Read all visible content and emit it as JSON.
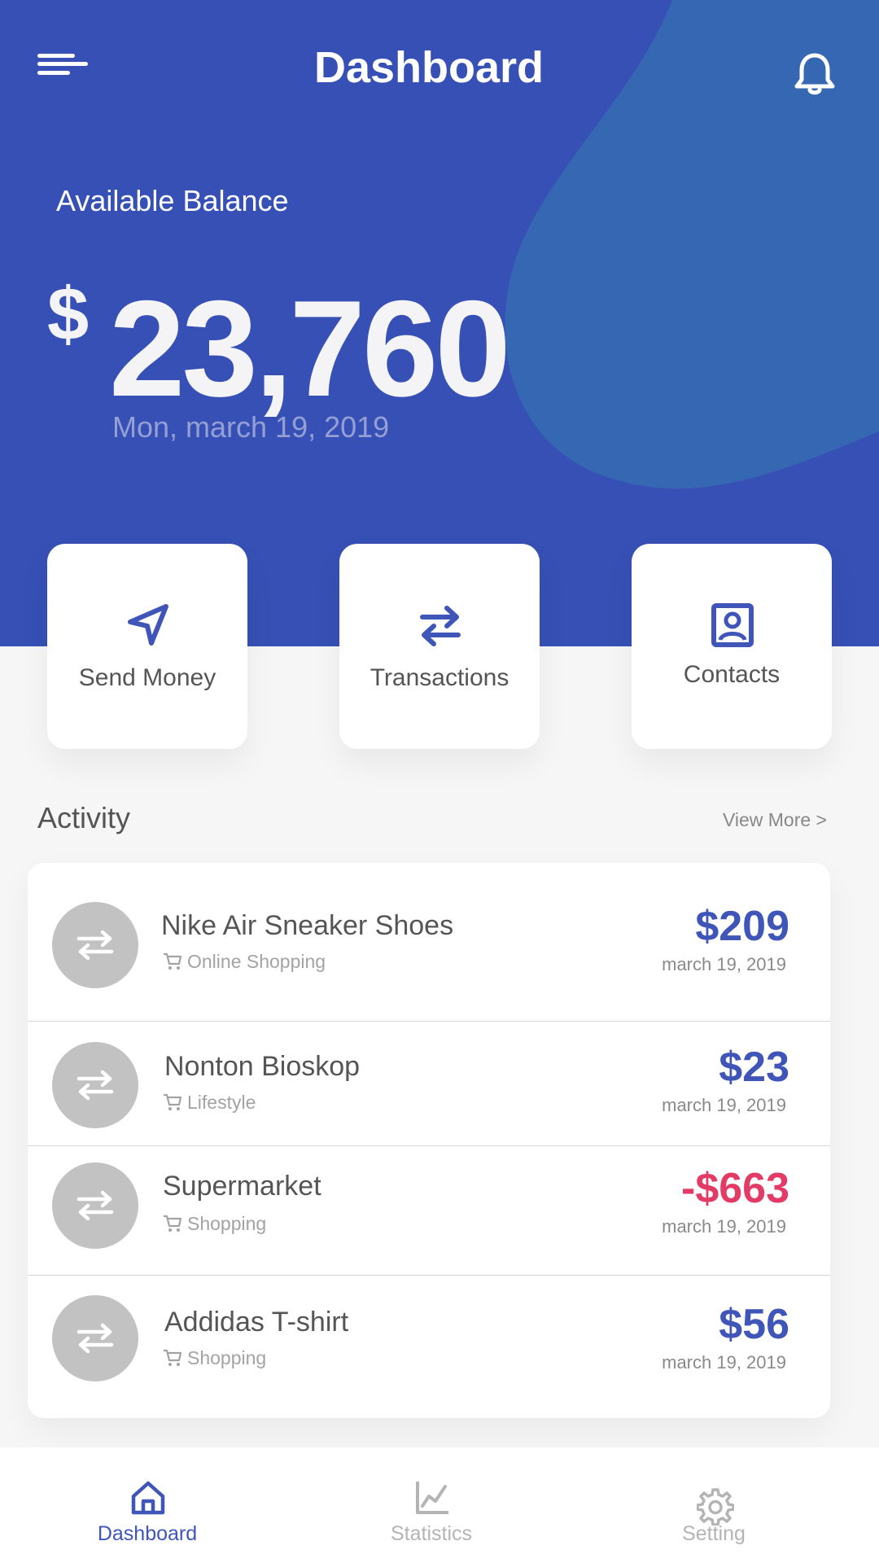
{
  "header": {
    "title": "Dashboard",
    "menu_icon": "hamburger-menu-icon",
    "notification_icon": "bell-icon"
  },
  "balance": {
    "label": "Available Balance",
    "currency": "$",
    "amount": "23,760",
    "date": "Mon, march 19, 2019"
  },
  "actions": [
    {
      "label": "Send Money",
      "icon": "send-icon"
    },
    {
      "label": "Transactions",
      "icon": "swap-arrows-icon"
    },
    {
      "label": "Contacts",
      "icon": "contact-book-icon"
    }
  ],
  "activity": {
    "title": "Activity",
    "view_more": "View More >",
    "items": [
      {
        "title": "Nike Air Sneaker Shoes",
        "category": "Online Shopping",
        "amount": "$209",
        "date": "march 19, 2019"
      },
      {
        "title": "Nonton Bioskop",
        "category": "Lifestyle",
        "amount": "$23",
        "date": "march 19, 2019"
      },
      {
        "title": "Supermarket",
        "category": "Shopping",
        "amount": "-$663",
        "date": "march 19, 2019"
      },
      {
        "title": "Addidas T-shirt",
        "category": "Shopping",
        "amount": "$56",
        "date": "march 19, 2019"
      }
    ]
  },
  "bottom_nav": [
    {
      "label": "Dashboard",
      "icon": "home-icon",
      "active": true
    },
    {
      "label": "Statistics",
      "icon": "chart-icon",
      "active": false
    },
    {
      "label": "Setting",
      "icon": "gear-icon",
      "active": false
    }
  ],
  "colors": {
    "primary": "#3750b5",
    "accent_blob": "#3567b2",
    "positive": "#3f55b8",
    "negative": "#e23b66"
  }
}
